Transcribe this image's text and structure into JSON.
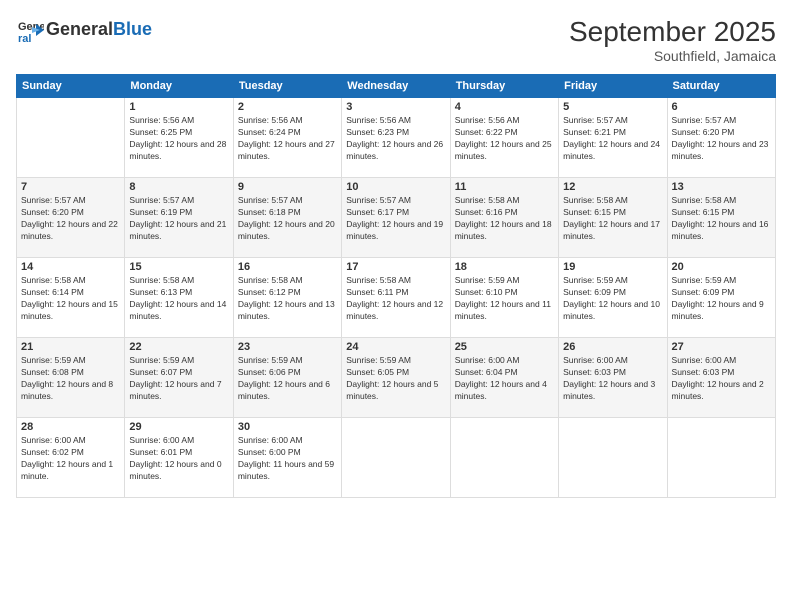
{
  "header": {
    "logo_general": "General",
    "logo_blue": "Blue",
    "month_title": "September 2025",
    "location": "Southfield, Jamaica"
  },
  "days_of_week": [
    "Sunday",
    "Monday",
    "Tuesday",
    "Wednesday",
    "Thursday",
    "Friday",
    "Saturday"
  ],
  "weeks": [
    [
      {
        "day": "",
        "sunrise": "",
        "sunset": "",
        "daylight": ""
      },
      {
        "day": "1",
        "sunrise": "Sunrise: 5:56 AM",
        "sunset": "Sunset: 6:25 PM",
        "daylight": "Daylight: 12 hours and 28 minutes."
      },
      {
        "day": "2",
        "sunrise": "Sunrise: 5:56 AM",
        "sunset": "Sunset: 6:24 PM",
        "daylight": "Daylight: 12 hours and 27 minutes."
      },
      {
        "day": "3",
        "sunrise": "Sunrise: 5:56 AM",
        "sunset": "Sunset: 6:23 PM",
        "daylight": "Daylight: 12 hours and 26 minutes."
      },
      {
        "day": "4",
        "sunrise": "Sunrise: 5:56 AM",
        "sunset": "Sunset: 6:22 PM",
        "daylight": "Daylight: 12 hours and 25 minutes."
      },
      {
        "day": "5",
        "sunrise": "Sunrise: 5:57 AM",
        "sunset": "Sunset: 6:21 PM",
        "daylight": "Daylight: 12 hours and 24 minutes."
      },
      {
        "day": "6",
        "sunrise": "Sunrise: 5:57 AM",
        "sunset": "Sunset: 6:20 PM",
        "daylight": "Daylight: 12 hours and 23 minutes."
      }
    ],
    [
      {
        "day": "7",
        "sunrise": "Sunrise: 5:57 AM",
        "sunset": "Sunset: 6:20 PM",
        "daylight": "Daylight: 12 hours and 22 minutes."
      },
      {
        "day": "8",
        "sunrise": "Sunrise: 5:57 AM",
        "sunset": "Sunset: 6:19 PM",
        "daylight": "Daylight: 12 hours and 21 minutes."
      },
      {
        "day": "9",
        "sunrise": "Sunrise: 5:57 AM",
        "sunset": "Sunset: 6:18 PM",
        "daylight": "Daylight: 12 hours and 20 minutes."
      },
      {
        "day": "10",
        "sunrise": "Sunrise: 5:57 AM",
        "sunset": "Sunset: 6:17 PM",
        "daylight": "Daylight: 12 hours and 19 minutes."
      },
      {
        "day": "11",
        "sunrise": "Sunrise: 5:58 AM",
        "sunset": "Sunset: 6:16 PM",
        "daylight": "Daylight: 12 hours and 18 minutes."
      },
      {
        "day": "12",
        "sunrise": "Sunrise: 5:58 AM",
        "sunset": "Sunset: 6:15 PM",
        "daylight": "Daylight: 12 hours and 17 minutes."
      },
      {
        "day": "13",
        "sunrise": "Sunrise: 5:58 AM",
        "sunset": "Sunset: 6:15 PM",
        "daylight": "Daylight: 12 hours and 16 minutes."
      }
    ],
    [
      {
        "day": "14",
        "sunrise": "Sunrise: 5:58 AM",
        "sunset": "Sunset: 6:14 PM",
        "daylight": "Daylight: 12 hours and 15 minutes."
      },
      {
        "day": "15",
        "sunrise": "Sunrise: 5:58 AM",
        "sunset": "Sunset: 6:13 PM",
        "daylight": "Daylight: 12 hours and 14 minutes."
      },
      {
        "day": "16",
        "sunrise": "Sunrise: 5:58 AM",
        "sunset": "Sunset: 6:12 PM",
        "daylight": "Daylight: 12 hours and 13 minutes."
      },
      {
        "day": "17",
        "sunrise": "Sunrise: 5:58 AM",
        "sunset": "Sunset: 6:11 PM",
        "daylight": "Daylight: 12 hours and 12 minutes."
      },
      {
        "day": "18",
        "sunrise": "Sunrise: 5:59 AM",
        "sunset": "Sunset: 6:10 PM",
        "daylight": "Daylight: 12 hours and 11 minutes."
      },
      {
        "day": "19",
        "sunrise": "Sunrise: 5:59 AM",
        "sunset": "Sunset: 6:09 PM",
        "daylight": "Daylight: 12 hours and 10 minutes."
      },
      {
        "day": "20",
        "sunrise": "Sunrise: 5:59 AM",
        "sunset": "Sunset: 6:09 PM",
        "daylight": "Daylight: 12 hours and 9 minutes."
      }
    ],
    [
      {
        "day": "21",
        "sunrise": "Sunrise: 5:59 AM",
        "sunset": "Sunset: 6:08 PM",
        "daylight": "Daylight: 12 hours and 8 minutes."
      },
      {
        "day": "22",
        "sunrise": "Sunrise: 5:59 AM",
        "sunset": "Sunset: 6:07 PM",
        "daylight": "Daylight: 12 hours and 7 minutes."
      },
      {
        "day": "23",
        "sunrise": "Sunrise: 5:59 AM",
        "sunset": "Sunset: 6:06 PM",
        "daylight": "Daylight: 12 hours and 6 minutes."
      },
      {
        "day": "24",
        "sunrise": "Sunrise: 5:59 AM",
        "sunset": "Sunset: 6:05 PM",
        "daylight": "Daylight: 12 hours and 5 minutes."
      },
      {
        "day": "25",
        "sunrise": "Sunrise: 6:00 AM",
        "sunset": "Sunset: 6:04 PM",
        "daylight": "Daylight: 12 hours and 4 minutes."
      },
      {
        "day": "26",
        "sunrise": "Sunrise: 6:00 AM",
        "sunset": "Sunset: 6:03 PM",
        "daylight": "Daylight: 12 hours and 3 minutes."
      },
      {
        "day": "27",
        "sunrise": "Sunrise: 6:00 AM",
        "sunset": "Sunset: 6:03 PM",
        "daylight": "Daylight: 12 hours and 2 minutes."
      }
    ],
    [
      {
        "day": "28",
        "sunrise": "Sunrise: 6:00 AM",
        "sunset": "Sunset: 6:02 PM",
        "daylight": "Daylight: 12 hours and 1 minute."
      },
      {
        "day": "29",
        "sunrise": "Sunrise: 6:00 AM",
        "sunset": "Sunset: 6:01 PM",
        "daylight": "Daylight: 12 hours and 0 minutes."
      },
      {
        "day": "30",
        "sunrise": "Sunrise: 6:00 AM",
        "sunset": "Sunset: 6:00 PM",
        "daylight": "Daylight: 11 hours and 59 minutes."
      },
      {
        "day": "",
        "sunrise": "",
        "sunset": "",
        "daylight": ""
      },
      {
        "day": "",
        "sunrise": "",
        "sunset": "",
        "daylight": ""
      },
      {
        "day": "",
        "sunrise": "",
        "sunset": "",
        "daylight": ""
      },
      {
        "day": "",
        "sunrise": "",
        "sunset": "",
        "daylight": ""
      }
    ]
  ]
}
